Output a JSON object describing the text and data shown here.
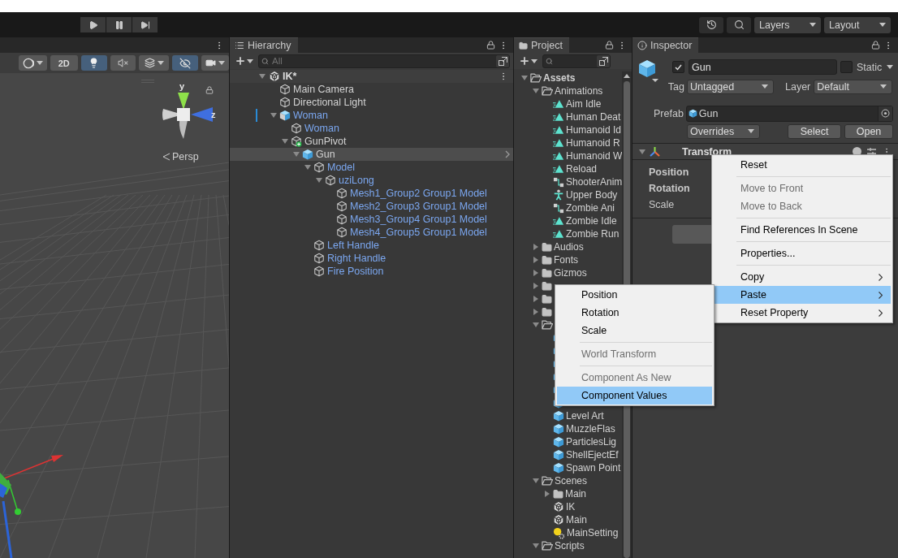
{
  "play_controls": [
    {
      "kind": "play"
    },
    {
      "kind": "pause"
    },
    {
      "kind": "step"
    }
  ],
  "toolbar_right": {
    "layers": "Layers",
    "layout": "Layout"
  },
  "scene": {
    "tools": [
      {
        "kind": "shading",
        "selected": false
      },
      {
        "kind": "text",
        "label": "2D",
        "selected": false
      },
      {
        "kind": "light",
        "selected": true
      },
      {
        "kind": "audio",
        "selected": false
      },
      {
        "kind": "effects",
        "selected": false
      },
      {
        "kind": "visibility",
        "selected": true
      },
      {
        "kind": "camera",
        "selected": false
      }
    ],
    "axes": [
      "y",
      "z"
    ],
    "projection": "Persp"
  },
  "hierarchy": {
    "title": "Hierarchy",
    "search_placeholder": "All",
    "scene": "IK*",
    "items": [
      {
        "label": "Main Camera",
        "kind": "object",
        "blue": false,
        "selected": false,
        "modified": false
      },
      {
        "label": "Directional Light",
        "kind": "object",
        "blue": false,
        "selected": false,
        "modified": false
      },
      {
        "label": "Woman",
        "kind": "model",
        "blue": true,
        "selected": false,
        "modified": true,
        "expanded": true,
        "children": [
          {
            "label": "Woman",
            "kind": "object",
            "blue": true,
            "selected": false,
            "modified": false
          },
          {
            "label": "GunPivot",
            "kind": "added",
            "blue": false,
            "selected": false,
            "modified": false,
            "expanded": true,
            "children": [
              {
                "label": "Gun",
                "kind": "prefab",
                "blue": false,
                "selected": true,
                "modified": false,
                "expanded": true,
                "children": [
                  {
                    "label": "Model",
                    "kind": "object",
                    "blue": true,
                    "selected": false,
                    "modified": false,
                    "expanded": true,
                    "children": [
                      {
                        "label": "uziLong",
                        "kind": "object",
                        "blue": true,
                        "selected": false,
                        "modified": false,
                        "expanded": true,
                        "children": [
                          {
                            "label": "Mesh1_Group2 Group1 Model",
                            "kind": "object",
                            "blue": true,
                            "selected": false,
                            "modified": false
                          },
                          {
                            "label": "Mesh2_Group3 Group1 Model",
                            "kind": "object",
                            "blue": true,
                            "selected": false,
                            "modified": false
                          },
                          {
                            "label": "Mesh3_Group4 Group1 Model",
                            "kind": "object",
                            "blue": true,
                            "selected": false,
                            "modified": false
                          },
                          {
                            "label": "Mesh4_Group5 Group1 Model",
                            "kind": "object",
                            "blue": true,
                            "selected": false,
                            "modified": false
                          }
                        ]
                      }
                    ]
                  },
                  {
                    "label": "Left Handle",
                    "kind": "object",
                    "blue": true,
                    "selected": false,
                    "modified": false
                  },
                  {
                    "label": "Right Handle",
                    "kind": "object",
                    "blue": true,
                    "selected": false,
                    "modified": false
                  },
                  {
                    "label": "Fire Position",
                    "kind": "object",
                    "blue": true,
                    "selected": false,
                    "modified": false
                  }
                ]
              }
            ]
          }
        ]
      }
    ]
  },
  "project": {
    "title": "Project",
    "items": [
      {
        "label": "Assets",
        "kind": "root",
        "expanded": true,
        "children": [
          {
            "label": "Animations",
            "kind": "folder",
            "expanded": true,
            "children": [
              {
                "label": "Aim Idle",
                "kind": "clip"
              },
              {
                "label": "Human Deat",
                "kind": "clip"
              },
              {
                "label": "Humanoid Id",
                "kind": "clip"
              },
              {
                "label": "Humanoid R",
                "kind": "clip"
              },
              {
                "label": "Humanoid W",
                "kind": "clip"
              },
              {
                "label": "Reload",
                "kind": "clip"
              },
              {
                "label": "ShooterAnim",
                "kind": "controller"
              },
              {
                "label": "Upper Body",
                "kind": "mask"
              },
              {
                "label": "Zombie Ani",
                "kind": "controller"
              },
              {
                "label": "Zombie Idle",
                "kind": "clip"
              },
              {
                "label": "Zombie Run",
                "kind": "clip"
              }
            ]
          },
          {
            "label": "Audios",
            "kind": "folder",
            "expanded": false
          },
          {
            "label": "Fonts",
            "kind": "folder",
            "expanded": false
          },
          {
            "label": "Gizmos",
            "kind": "folder",
            "expanded": false
          },
          {
            "kind": "folder",
            "expanded": false
          },
          {
            "kind": "folder",
            "expanded": false
          },
          {
            "kind": "folder",
            "expanded": false
          },
          {
            "kind": "folder",
            "expanded": true,
            "children": [
              {
                "kind": "prefab"
              },
              {
                "kind": "prefab"
              },
              {
                "kind": "prefab"
              },
              {
                "kind": "prefab"
              },
              {
                "kind": "prefab"
              },
              {
                "kind": "prefab"
              },
              {
                "label": "Level Art",
                "kind": "prefab"
              },
              {
                "label": "MuzzleFlas",
                "kind": "prefab"
              },
              {
                "label": "ParticlesLig",
                "kind": "prefab"
              },
              {
                "label": "ShellEjectEf",
                "kind": "prefab"
              },
              {
                "label": "Spawn Point",
                "kind": "prefab"
              }
            ]
          },
          {
            "label": "Scenes",
            "kind": "folder",
            "expanded": true,
            "children": [
              {
                "label": "Main",
                "kind": "folder",
                "expanded": false
              },
              {
                "label": "IK",
                "kind": "scene"
              },
              {
                "label": "Main",
                "kind": "scene"
              },
              {
                "label": "MainSetting",
                "kind": "settings"
              }
            ]
          },
          {
            "label": "Scripts",
            "kind": "folder",
            "expanded": true
          }
        ]
      }
    ]
  },
  "inspector": {
    "title": "Inspector",
    "active": true,
    "name": "Gun",
    "static": false,
    "static_label": "Static",
    "tag_label": "Tag",
    "tag": "Untagged",
    "layer_label": "Layer",
    "layer": "Default",
    "prefab_label": "Prefab",
    "prefab": "Gun",
    "overrides": "Overrides",
    "buttons": [
      "Select",
      "Open"
    ],
    "component": {
      "title": "Transform",
      "expanded": true,
      "properties": [
        {
          "label": "Position",
          "bold": true
        },
        {
          "label": "Rotation",
          "bold": true
        },
        {
          "label": "Scale",
          "bold": false
        }
      ]
    }
  },
  "context_menu": {
    "items": [
      {
        "kind": "item",
        "label": "Reset",
        "disabled": false,
        "selected": false,
        "submenu": false
      },
      {
        "kind": "separator"
      },
      {
        "kind": "item",
        "label": "Move to Front",
        "disabled": true,
        "selected": false,
        "submenu": false
      },
      {
        "kind": "item",
        "label": "Move to Back",
        "disabled": true,
        "selected": false,
        "submenu": false
      },
      {
        "kind": "separator"
      },
      {
        "kind": "item",
        "label": "Find References In Scene",
        "disabled": false,
        "selected": false,
        "submenu": false
      },
      {
        "kind": "separator"
      },
      {
        "kind": "item",
        "label": "Properties...",
        "disabled": false,
        "selected": false,
        "submenu": false
      },
      {
        "kind": "separator"
      },
      {
        "kind": "item",
        "label": "Copy",
        "disabled": false,
        "selected": false,
        "submenu": true
      },
      {
        "kind": "item",
        "label": "Paste",
        "disabled": false,
        "selected": true,
        "submenu": true
      },
      {
        "kind": "item",
        "label": "Reset Property",
        "disabled": false,
        "selected": false,
        "submenu": true
      }
    ]
  },
  "submenu": {
    "items": [
      {
        "kind": "item",
        "label": "Position",
        "disabled": false,
        "selected": false,
        "submenu": false
      },
      {
        "kind": "item",
        "label": "Rotation",
        "disabled": false,
        "selected": false,
        "submenu": false
      },
      {
        "kind": "item",
        "label": "Scale",
        "disabled": false,
        "selected": false,
        "submenu": false
      },
      {
        "kind": "separator"
      },
      {
        "kind": "item",
        "label": "World Transform",
        "disabled": true,
        "selected": false,
        "submenu": false
      },
      {
        "kind": "separator"
      },
      {
        "kind": "item",
        "label": "Component As New",
        "disabled": true,
        "selected": false,
        "submenu": false
      },
      {
        "kind": "item",
        "label": "Component Values",
        "disabled": false,
        "selected": true,
        "submenu": false
      }
    ]
  }
}
